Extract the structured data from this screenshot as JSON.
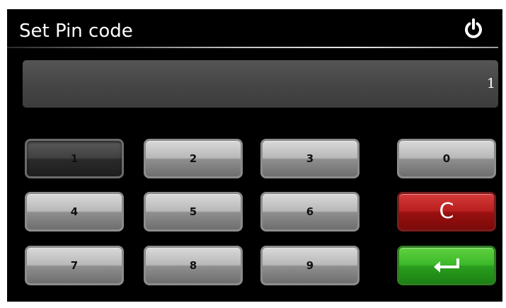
{
  "header": {
    "title": "Set Pin code",
    "power_icon": "power-icon"
  },
  "display": {
    "value": "1"
  },
  "keypad": {
    "keys": [
      "1",
      "2",
      "3",
      "0",
      "4",
      "5",
      "6",
      "7",
      "8",
      "9"
    ],
    "clear_label": "C",
    "enter_icon": "enter-return-icon",
    "pressed_key": "1"
  },
  "colors": {
    "background": "#000000",
    "key_gray": "#b8b8b8",
    "clear_red": "#b81f1f",
    "enter_green": "#3cb82a",
    "text_white": "#ffffff"
  }
}
